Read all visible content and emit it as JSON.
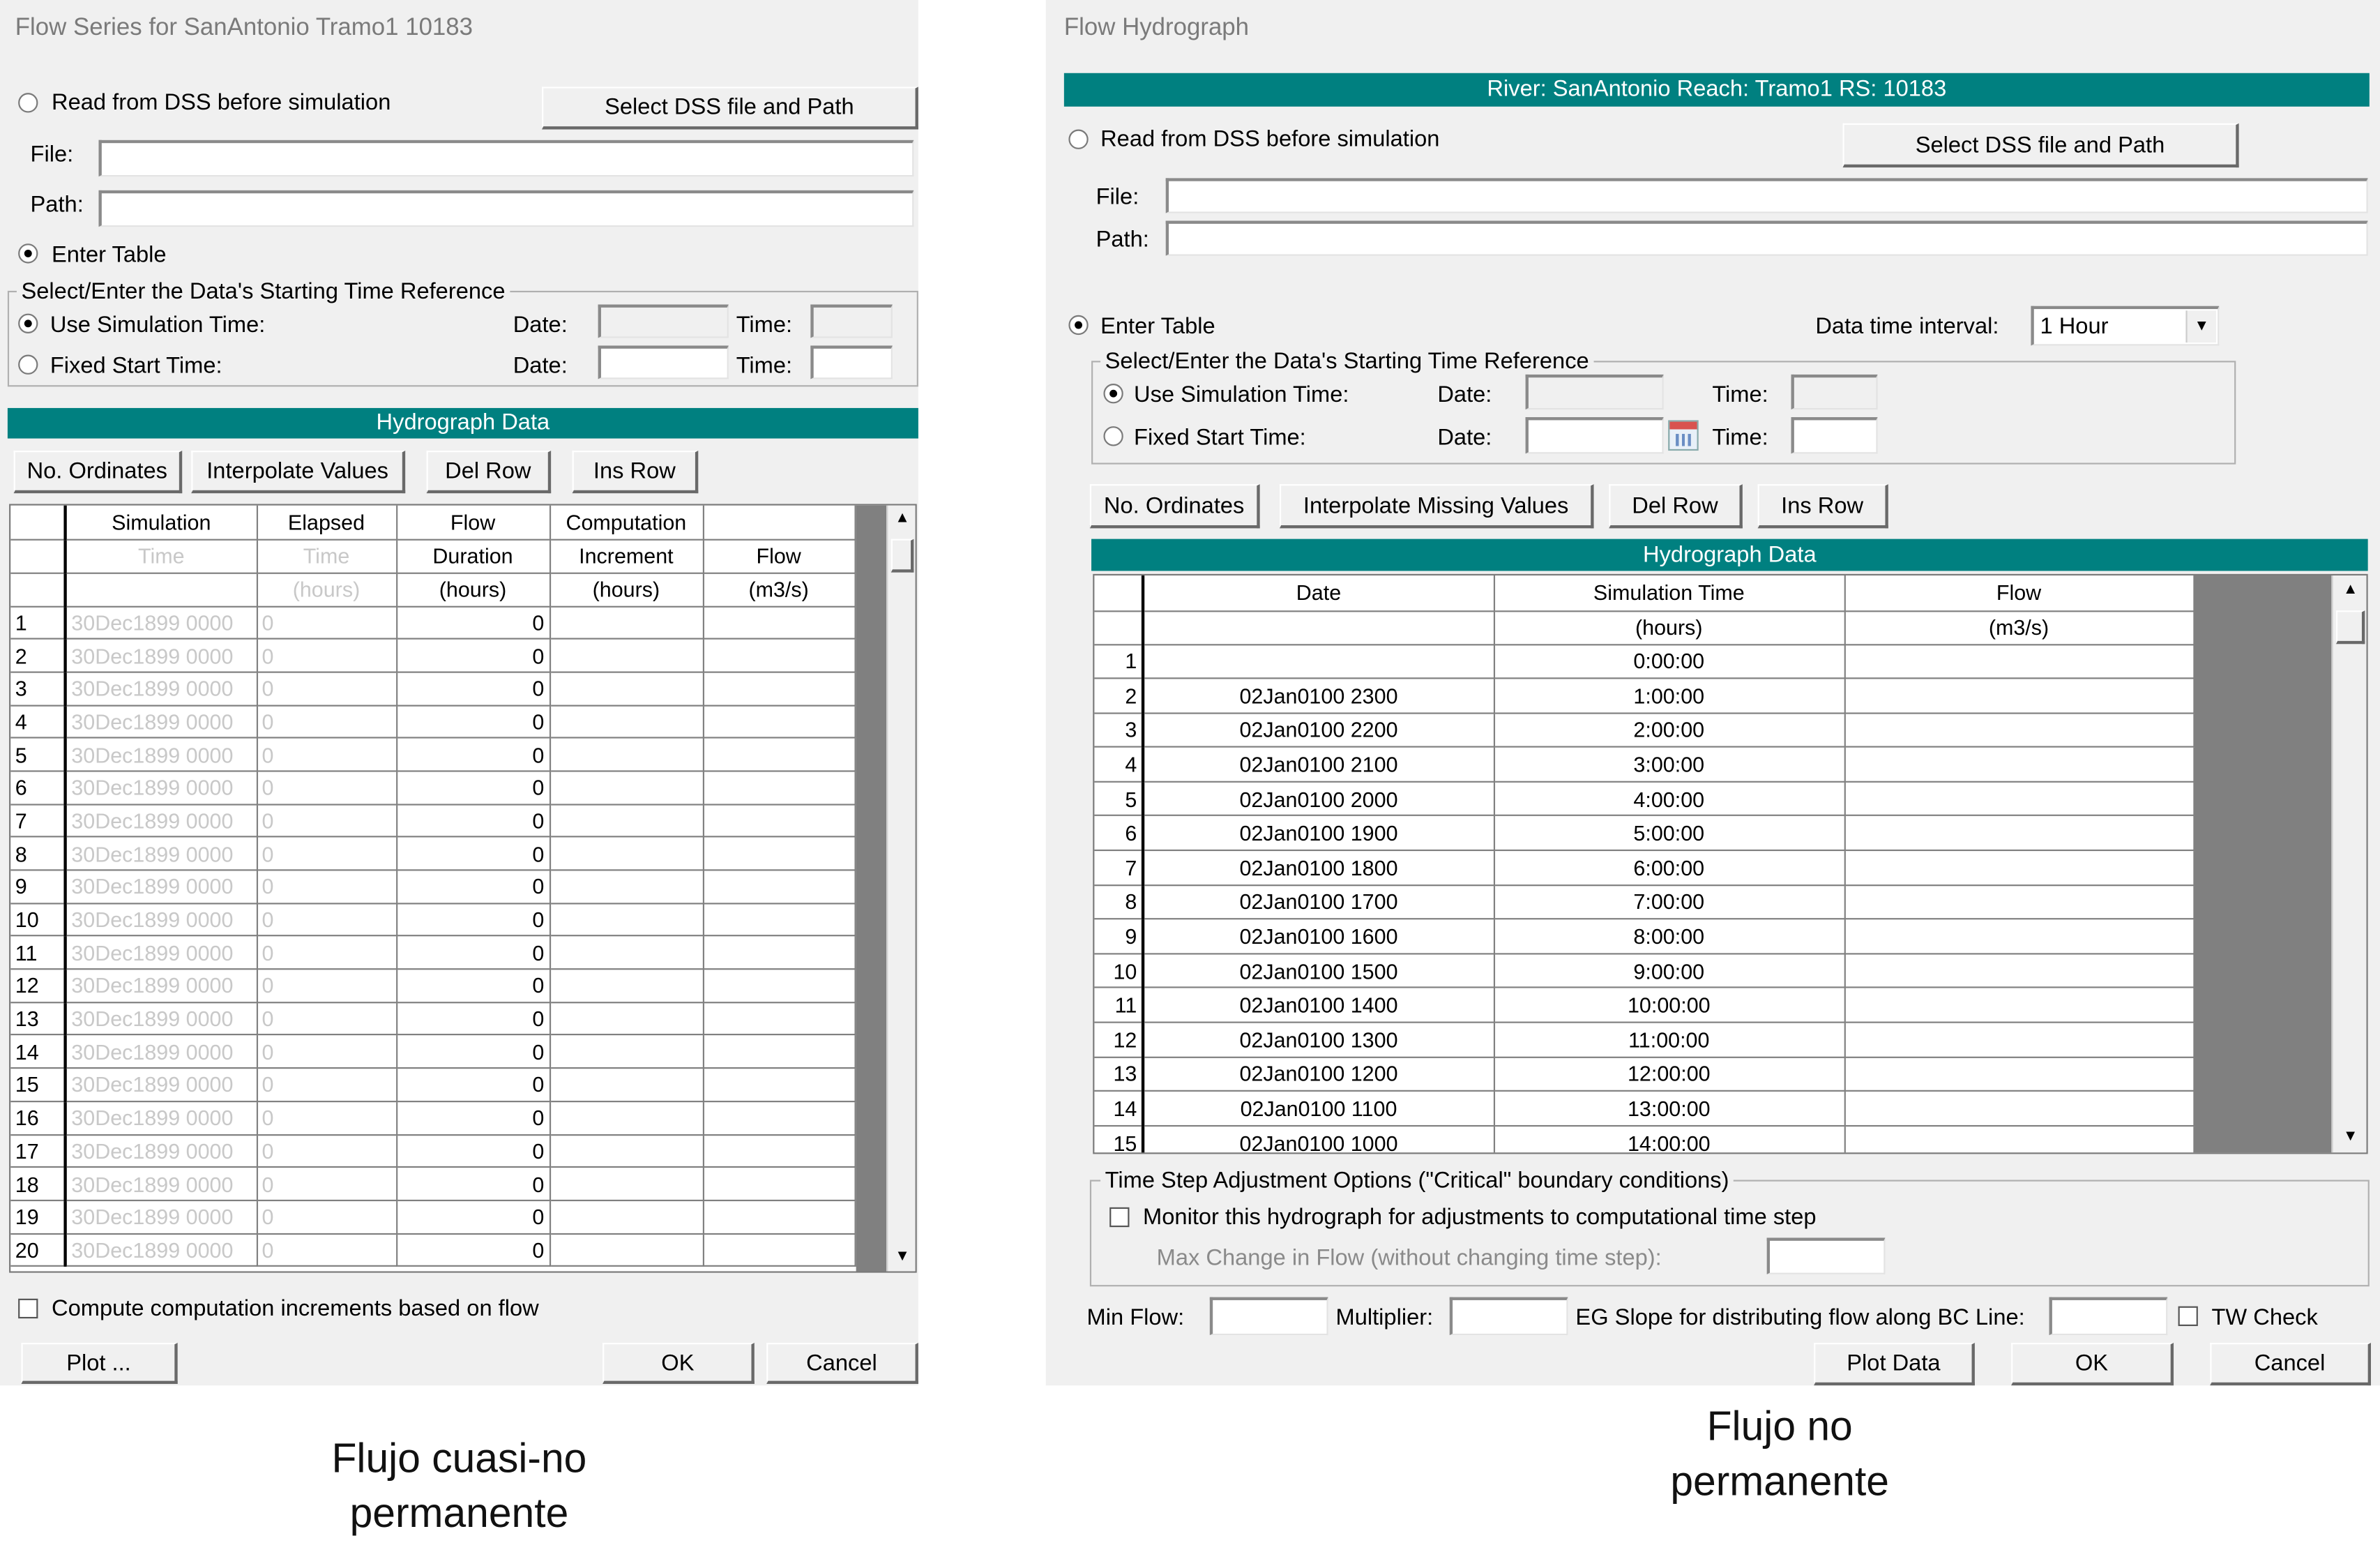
{
  "left_window": {
    "title": "Flow Series for SanAntonio Tramo1 10183",
    "read_dss_label": "Read from DSS before simulation",
    "select_dss_button": "Select DSS file and Path",
    "file_label": "File:",
    "path_label": "Path:",
    "enter_table_label": "Enter Table",
    "time_ref_group_label": "Select/Enter the Data's Starting Time Reference",
    "use_sim_time_label": "Use Simulation Time:",
    "fixed_start_label": "Fixed Start Time:",
    "date_label": "Date:",
    "time_label": "Time:",
    "hydrograph_bar": "Hydrograph Data",
    "buttons": {
      "no_ordinates": "No. Ordinates",
      "interpolate": "Interpolate Values",
      "del_row": "Del Row",
      "ins_row": "Ins Row"
    },
    "columns": [
      {
        "line1": "Simulation",
        "line2": "Time",
        "line3": ""
      },
      {
        "line1": "Elapsed",
        "line2": "Time",
        "line3": "(hours)"
      },
      {
        "line1": "Flow",
        "line2": "Duration",
        "line3": "(hours)"
      },
      {
        "line1": "Computation",
        "line2": "Increment",
        "line3": "(hours)"
      },
      {
        "line1": "",
        "line2": "Flow",
        "line3": "(m3/s)"
      }
    ],
    "rows": [
      {
        "n": "1",
        "sim": "30Dec1899 0000",
        "elapsed": "0",
        "duration": "0"
      },
      {
        "n": "2",
        "sim": "30Dec1899 0000",
        "elapsed": "0",
        "duration": "0"
      },
      {
        "n": "3",
        "sim": "30Dec1899 0000",
        "elapsed": "0",
        "duration": "0"
      },
      {
        "n": "4",
        "sim": "30Dec1899 0000",
        "elapsed": "0",
        "duration": "0"
      },
      {
        "n": "5",
        "sim": "30Dec1899 0000",
        "elapsed": "0",
        "duration": "0"
      },
      {
        "n": "6",
        "sim": "30Dec1899 0000",
        "elapsed": "0",
        "duration": "0"
      },
      {
        "n": "7",
        "sim": "30Dec1899 0000",
        "elapsed": "0",
        "duration": "0"
      },
      {
        "n": "8",
        "sim": "30Dec1899 0000",
        "elapsed": "0",
        "duration": "0"
      },
      {
        "n": "9",
        "sim": "30Dec1899 0000",
        "elapsed": "0",
        "duration": "0"
      },
      {
        "n": "10",
        "sim": "30Dec1899 0000",
        "elapsed": "0",
        "duration": "0"
      },
      {
        "n": "11",
        "sim": "30Dec1899 0000",
        "elapsed": "0",
        "duration": "0"
      },
      {
        "n": "12",
        "sim": "30Dec1899 0000",
        "elapsed": "0",
        "duration": "0"
      },
      {
        "n": "13",
        "sim": "30Dec1899 0000",
        "elapsed": "0",
        "duration": "0"
      },
      {
        "n": "14",
        "sim": "30Dec1899 0000",
        "elapsed": "0",
        "duration": "0"
      },
      {
        "n": "15",
        "sim": "30Dec1899 0000",
        "elapsed": "0",
        "duration": "0"
      },
      {
        "n": "16",
        "sim": "30Dec1899 0000",
        "elapsed": "0",
        "duration": "0"
      },
      {
        "n": "17",
        "sim": "30Dec1899 0000",
        "elapsed": "0",
        "duration": "0"
      },
      {
        "n": "18",
        "sim": "30Dec1899 0000",
        "elapsed": "0",
        "duration": "0"
      },
      {
        "n": "19",
        "sim": "30Dec1899 0000",
        "elapsed": "0",
        "duration": "0"
      },
      {
        "n": "20",
        "sim": "30Dec1899 0000",
        "elapsed": "0",
        "duration": "0"
      }
    ],
    "compute_increments_label": "Compute computation increments based on flow",
    "plot_button": "Plot ...",
    "ok_button": "OK",
    "cancel_button": "Cancel"
  },
  "right_window": {
    "title": "Flow Hydrograph",
    "river_bar": "River: SanAntonio  Reach: Tramo1  RS: 10183",
    "read_dss_label": "Read from DSS before simulation",
    "select_dss_button": "Select DSS file and Path",
    "file_label": "File:",
    "path_label": "Path:",
    "enter_table_label": "Enter Table",
    "data_interval_label": "Data time interval:",
    "data_interval_value": "1 Hour",
    "time_ref_group_label": "Select/Enter the Data's Starting Time Reference",
    "use_sim_time_label": "Use Simulation Time:",
    "fixed_start_label": "Fixed Start Time:",
    "date_label": "Date:",
    "time_label": "Time:",
    "buttons": {
      "no_ordinates": "No. Ordinates",
      "interpolate_missing": "Interpolate Missing Values",
      "del_row": "Del Row",
      "ins_row": "Ins Row"
    },
    "hydrograph_bar": "Hydrograph Data",
    "columns": [
      {
        "line1": "Date",
        "line2": ""
      },
      {
        "line1": "Simulation Time",
        "line2": "(hours)"
      },
      {
        "line1": "Flow",
        "line2": "(m3/s)"
      }
    ],
    "rows": [
      {
        "n": "1",
        "date": "",
        "sim": "0:00:00"
      },
      {
        "n": "2",
        "date": "02Jan0100 2300",
        "sim": "1:00:00"
      },
      {
        "n": "3",
        "date": "02Jan0100 2200",
        "sim": "2:00:00"
      },
      {
        "n": "4",
        "date": "02Jan0100 2100",
        "sim": "3:00:00"
      },
      {
        "n": "5",
        "date": "02Jan0100 2000",
        "sim": "4:00:00"
      },
      {
        "n": "6",
        "date": "02Jan0100 1900",
        "sim": "5:00:00"
      },
      {
        "n": "7",
        "date": "02Jan0100 1800",
        "sim": "6:00:00"
      },
      {
        "n": "8",
        "date": "02Jan0100 1700",
        "sim": "7:00:00"
      },
      {
        "n": "9",
        "date": "02Jan0100 1600",
        "sim": "8:00:00"
      },
      {
        "n": "10",
        "date": "02Jan0100 1500",
        "sim": "9:00:00"
      },
      {
        "n": "11",
        "date": "02Jan0100 1400",
        "sim": "10:00:00"
      },
      {
        "n": "12",
        "date": "02Jan0100 1300",
        "sim": "11:00:00"
      },
      {
        "n": "13",
        "date": "02Jan0100 1200",
        "sim": "12:00:00"
      },
      {
        "n": "14",
        "date": "02Jan0100 1100",
        "sim": "13:00:00"
      },
      {
        "n": "15",
        "date": "02Jan0100 1000",
        "sim": "14:00:00"
      }
    ],
    "time_step_group_label": "Time Step Adjustment Options (\"Critical\" boundary conditions)",
    "monitor_label": "Monitor this hydrograph for adjustments to computational time step",
    "max_change_label": "Max Change in Flow (without changing time step):",
    "min_flow_label": "Min Flow:",
    "multiplier_label": "Multiplier:",
    "eg_slope_label": "EG Slope for distributing flow along BC Line:",
    "tw_check_label": "TW Check",
    "plot_data_button": "Plot Data",
    "ok_button": "OK",
    "cancel_button": "Cancel"
  },
  "captions": {
    "left_line1": "Flujo cuasi-no",
    "left_line2": "permanente",
    "right_line1": "Flujo no",
    "right_line2": "permanente"
  },
  "colors": {
    "accent": "#008080",
    "window_bg": "#f0f0f0",
    "grid_dark": "#808080"
  },
  "icons": {
    "calendar": "calendar-icon",
    "dropdown": "chevron-down-icon"
  }
}
